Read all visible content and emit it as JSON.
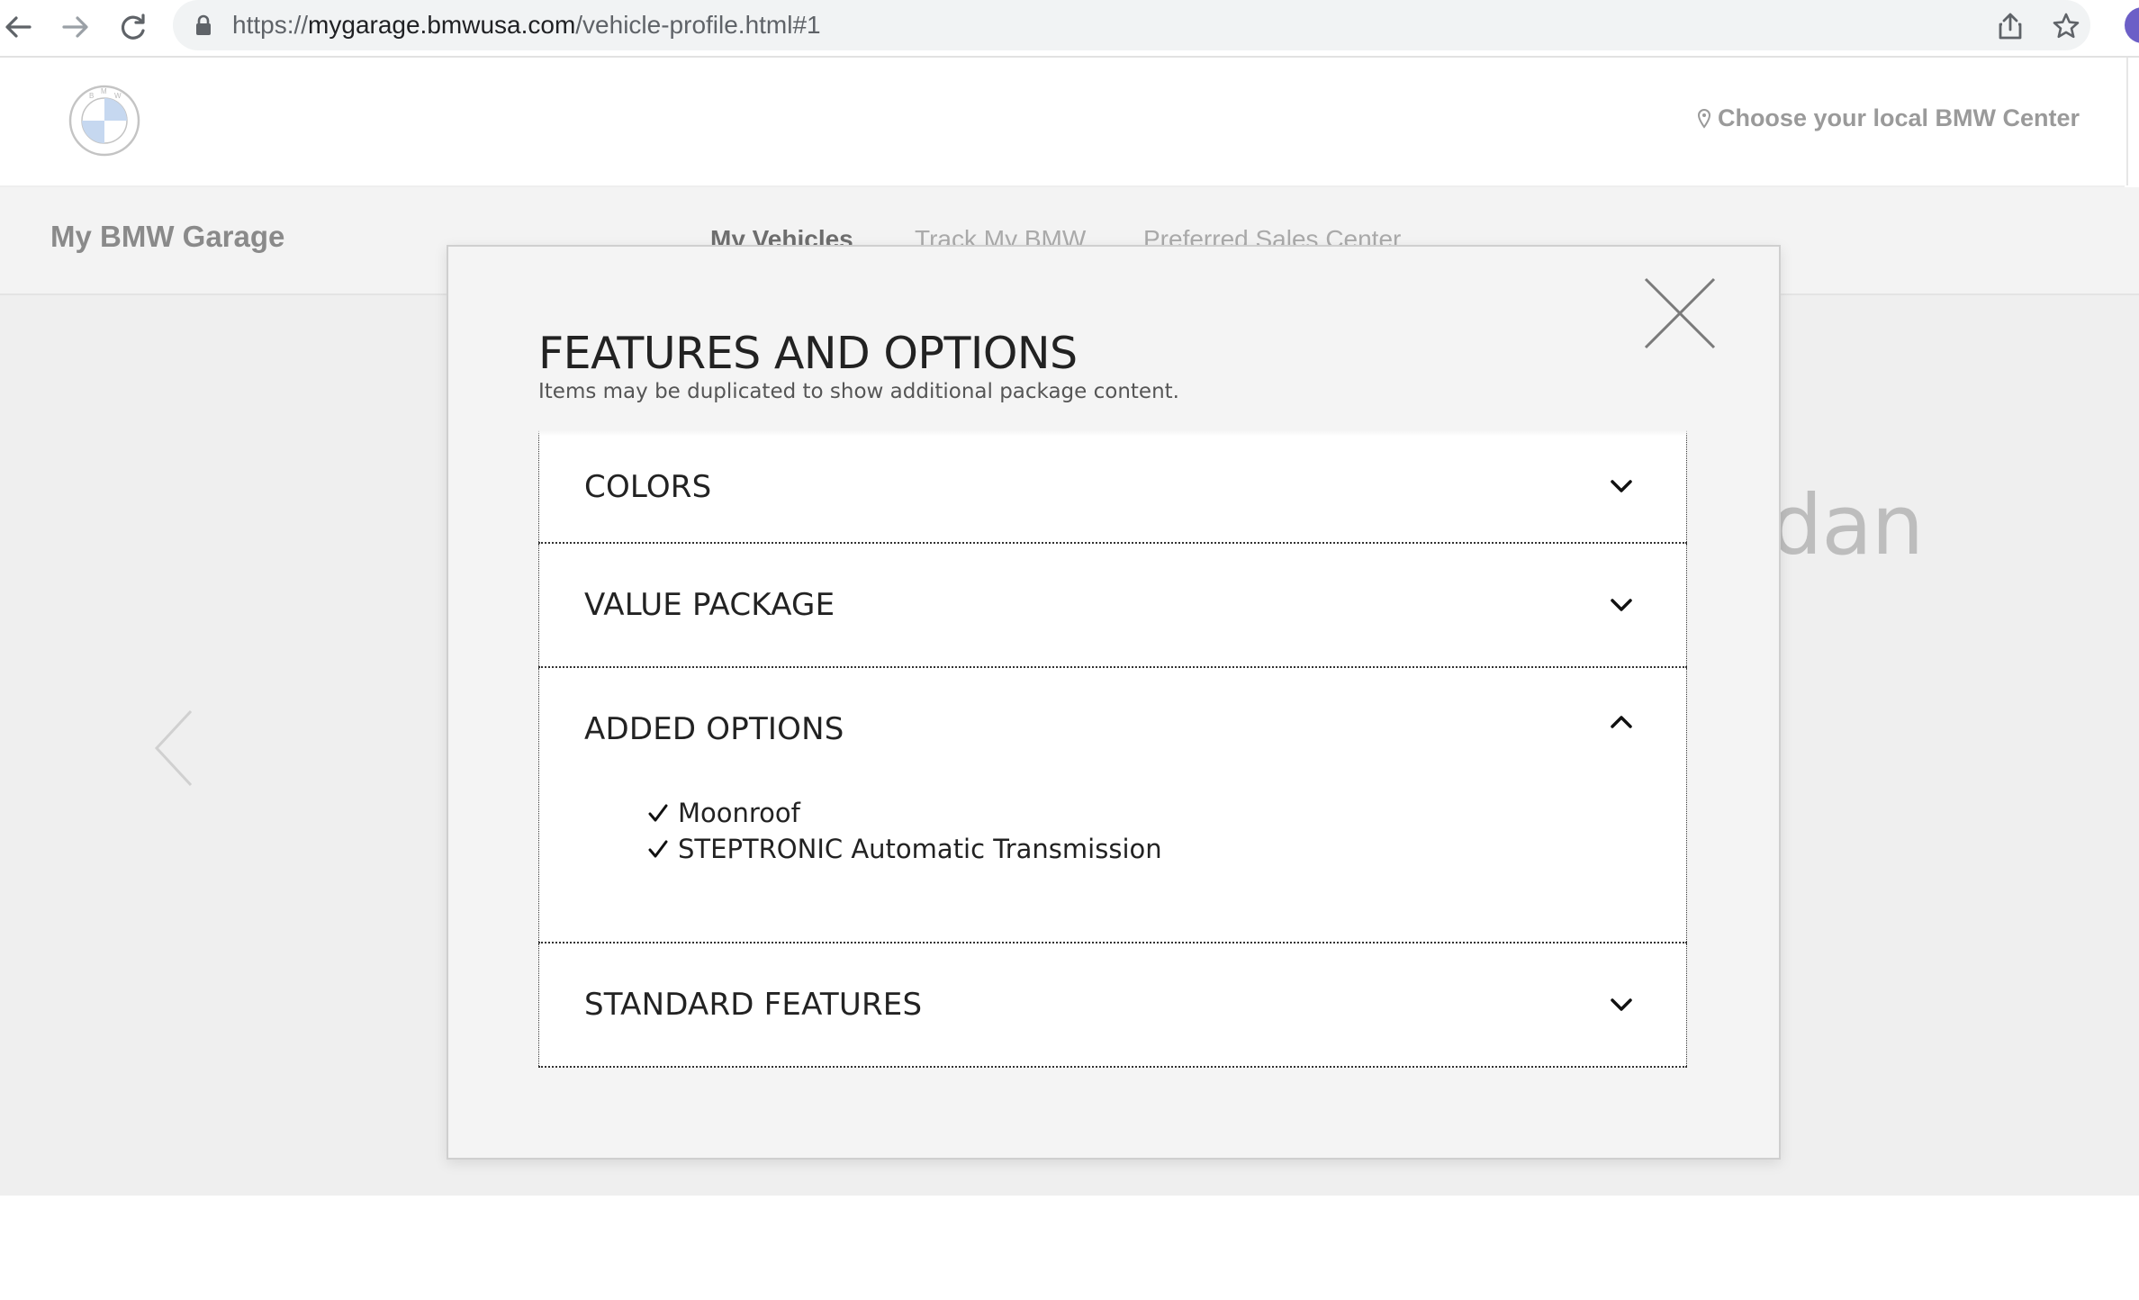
{
  "browser": {
    "url_scheme": "https://",
    "url_host": "mygarage.bmwusa.com",
    "url_path": "/vehicle-profile.html#1",
    "profile_color": "#6c5fc7"
  },
  "header": {
    "logo_icon": "bmw-roundel-logo",
    "dealer_link": "Choose your local BMW Center"
  },
  "subnav": {
    "title": "My BMW Garage",
    "links": [
      {
        "label": "My Vehicles",
        "active": true
      },
      {
        "label": "Track My BMW",
        "active": false
      },
      {
        "label": "Preferred Sales Center",
        "active": false
      }
    ]
  },
  "page": {
    "model_name_fragment": "dan"
  },
  "modal": {
    "title": "FEATURES AND OPTIONS",
    "subtitle": "Items may be duplicated to show additional package content.",
    "sections": [
      {
        "label": "COLORS",
        "expanded": false,
        "items": []
      },
      {
        "label": "VALUE PACKAGE",
        "expanded": false,
        "items": []
      },
      {
        "label": "ADDED OPTIONS",
        "expanded": true,
        "items": [
          "Moonroof",
          "STEPTRONIC Automatic Transmission"
        ]
      },
      {
        "label": "STANDARD FEATURES",
        "expanded": false,
        "items": []
      }
    ]
  },
  "colors": {
    "modal_bg": "#f4f4f4",
    "page_bg": "#efefef",
    "text_dark": "#222222",
    "text_muted": "#9a9a9a",
    "bmw_blue": "#c6d8f0"
  }
}
